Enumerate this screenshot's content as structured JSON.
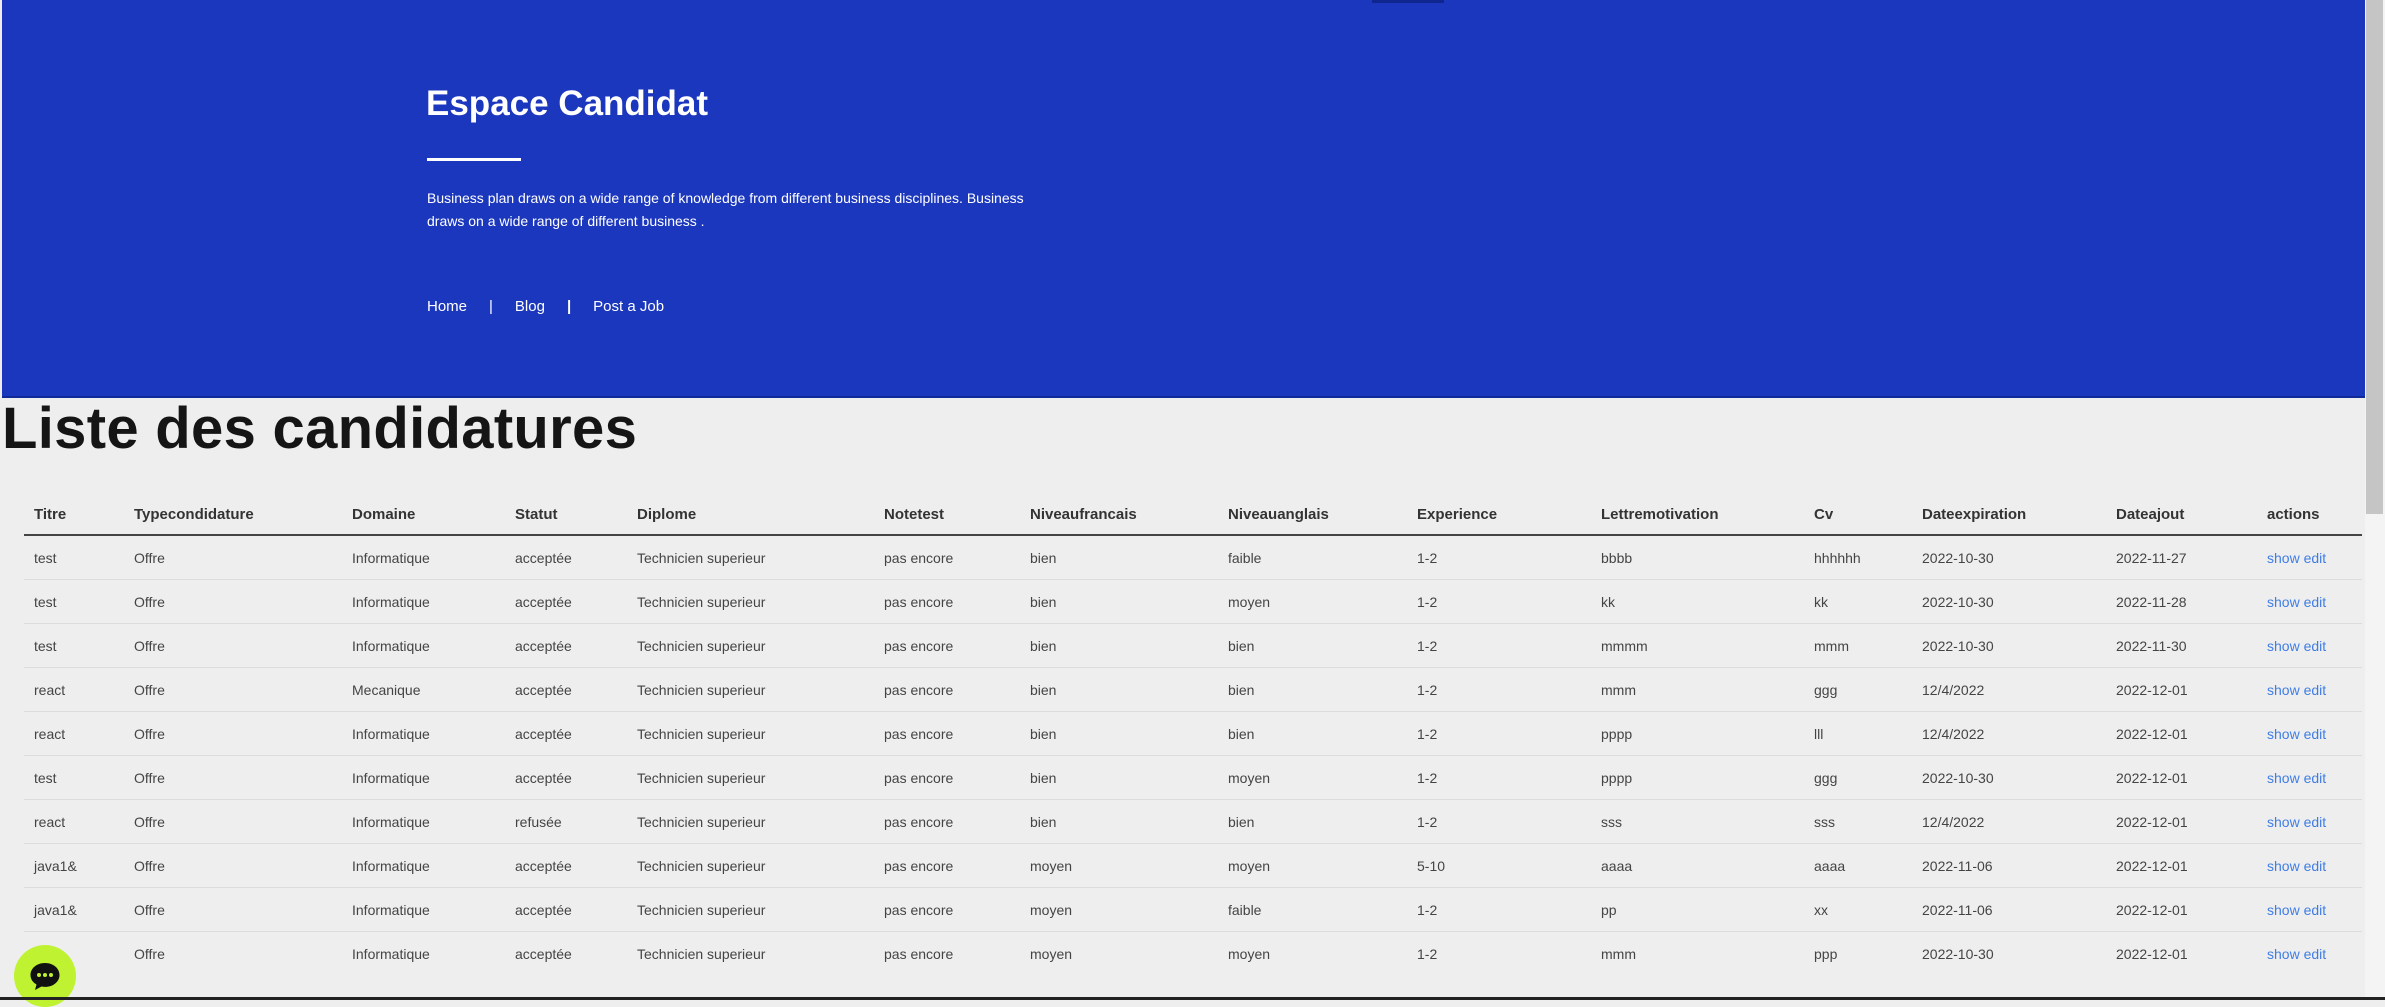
{
  "hero": {
    "title": "Espace Candidat",
    "description": "Business plan draws on a wide range of knowledge from different business disciplines. Business draws on a wide range of different business .",
    "nav": {
      "home": "Home",
      "blog": "Blog",
      "post_job": "Post a Job",
      "separator": "|"
    },
    "background_color": "#1b37bd"
  },
  "page_title": "Liste des candidatures",
  "table": {
    "columns": [
      "Titre",
      "Typecondidature",
      "Domaine",
      "Statut",
      "Diplome",
      "Notetest",
      "Niveaufrancais",
      "Niveauanglais",
      "Experience",
      "Lettremotivation",
      "Cv",
      "Dateexpiration",
      "Dateajout",
      "actions"
    ],
    "action_show": "show",
    "action_edit": "edit",
    "rows": [
      [
        "test",
        "Offre",
        "Informatique",
        "acceptée",
        "Technicien superieur",
        "pas encore",
        "bien",
        "faible",
        "1-2",
        "bbbb",
        "hhhhhh",
        "2022-10-30",
        "2022-11-27"
      ],
      [
        "test",
        "Offre",
        "Informatique",
        "acceptée",
        "Technicien superieur",
        "pas encore",
        "bien",
        "moyen",
        "1-2",
        "kk",
        "kk",
        "2022-10-30",
        "2022-11-28"
      ],
      [
        "test",
        "Offre",
        "Informatique",
        "acceptée",
        "Technicien superieur",
        "pas encore",
        "bien",
        "bien",
        "1-2",
        "mmmm",
        "mmm",
        "2022-10-30",
        "2022-11-30"
      ],
      [
        "react",
        "Offre",
        "Mecanique",
        "acceptée",
        "Technicien superieur",
        "pas encore",
        "bien",
        "bien",
        "1-2",
        "mmm",
        "ggg",
        "12/4/2022",
        "2022-12-01"
      ],
      [
        "react",
        "Offre",
        "Informatique",
        "acceptée",
        "Technicien superieur",
        "pas encore",
        "bien",
        "bien",
        "1-2",
        "pppp",
        "lll",
        "12/4/2022",
        "2022-12-01"
      ],
      [
        "test",
        "Offre",
        "Informatique",
        "acceptée",
        "Technicien superieur",
        "pas encore",
        "bien",
        "moyen",
        "1-2",
        "pppp",
        "ggg",
        "2022-10-30",
        "2022-12-01"
      ],
      [
        "react",
        "Offre",
        "Informatique",
        "refusée",
        "Technicien superieur",
        "pas encore",
        "bien",
        "bien",
        "1-2",
        "sss",
        "sss",
        "12/4/2022",
        "2022-12-01"
      ],
      [
        "java1&",
        "Offre",
        "Informatique",
        "acceptée",
        "Technicien superieur",
        "pas encore",
        "moyen",
        "moyen",
        "5-10",
        "aaaa",
        "aaaa",
        "2022-11-06",
        "2022-12-01"
      ],
      [
        "java1&",
        "Offre",
        "Informatique",
        "acceptée",
        "Technicien superieur",
        "pas encore",
        "moyen",
        "faible",
        "1-2",
        "pp",
        "xx",
        "2022-11-06",
        "2022-12-01"
      ],
      [
        "",
        "Offre",
        "Informatique",
        "acceptée",
        "Technicien superieur",
        "pas encore",
        "moyen",
        "moyen",
        "1-2",
        "mmm",
        "ppp",
        "2022-10-30",
        "2022-12-01"
      ]
    ]
  },
  "chat_widget": {
    "icon": "chat-bubble-icon",
    "color": "#bff231"
  }
}
